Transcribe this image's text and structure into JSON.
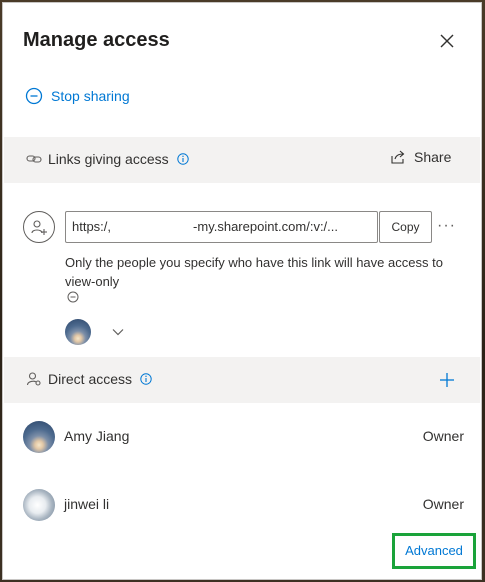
{
  "dialog": {
    "title": "Manage access"
  },
  "stop_sharing": {
    "label": "Stop sharing"
  },
  "links_section": {
    "label": "Links giving access",
    "share_label": "Share"
  },
  "link": {
    "url_start": "https:/,",
    "url_end": "-my.sharepoint.com/:v:/...",
    "copy_label": "Copy",
    "more_label": "···",
    "description": "Only the people you specify who have this link will have access to view-only"
  },
  "direct_section": {
    "label": "Direct access"
  },
  "people": [
    {
      "name": "Amy Jiang",
      "role": "Owner"
    },
    {
      "name": "jinwei li",
      "role": "Owner"
    }
  ],
  "footer": {
    "advanced_label": "Advanced"
  },
  "colors": {
    "accent": "#0078d4",
    "highlight": "#1aa33a",
    "section_bg": "#f3f2f1"
  }
}
